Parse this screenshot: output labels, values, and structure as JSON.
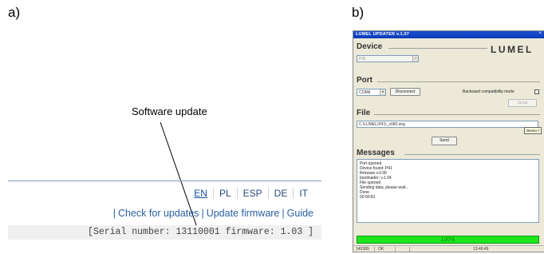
{
  "panel_labels": {
    "a": "a)",
    "b": "b)"
  },
  "panel_a": {
    "callout": "Software update",
    "languages": [
      "EN",
      "PL",
      "ESP",
      "DE",
      "IT"
    ],
    "links": [
      "Check for updates",
      "Update firmware",
      "Guide"
    ],
    "separator": "|",
    "serial_text": "[Serial number: 13110001 firmware: 1.03 ]"
  },
  "panel_b": {
    "window_title": "LUMEL UPDATER v.1.07",
    "close_glyph": "×",
    "logo": "LUMEL",
    "device": {
      "heading": "Device",
      "selected": "P41",
      "combo_arrow": "▾"
    },
    "port": {
      "heading": "Port",
      "selected": "COM6",
      "disconnect_label": "Disconnect",
      "backward_label": "Backward compatibility mode",
      "setup_label": "Setup"
    },
    "file": {
      "heading": "File",
      "path": "C:\\LUMEL\\P41\\_v080.img",
      "tooltip": "Device f",
      "send_label": "Send"
    },
    "messages": {
      "heading": "Messages",
      "lines": [
        "Port opened",
        "Device found: P41",
        "firmware v.0.90",
        "bootloader: v.1.04",
        "File opened",
        "Sending data, please wait...",
        "Done",
        "00:00:81"
      ]
    },
    "progress": {
      "percent": 100,
      "label": "100%"
    },
    "status": [
      "145389",
      "OK",
      "",
      "13:49:49"
    ],
    "colors": {
      "progress_fill": "#1ee61e",
      "titlebar": "#0a3cb8"
    }
  }
}
